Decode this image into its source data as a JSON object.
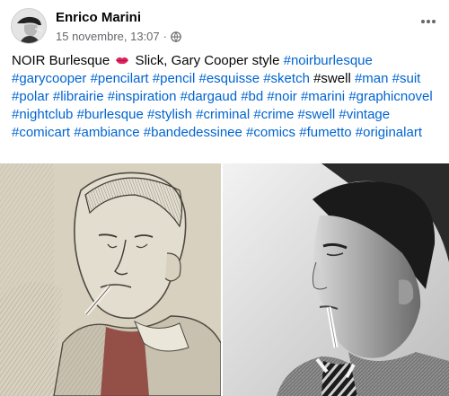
{
  "author": {
    "name": "Enrico Marini"
  },
  "meta": {
    "timestamp": "15 novembre, 13:07",
    "separator": "·",
    "audience_icon": "globe-icon"
  },
  "more_icon": "ellipsis-icon",
  "post": {
    "intro": "NOIR Burlesque",
    "emoji": "kiss-lips-emoji",
    "caption": " Slick, Gary Cooper style ",
    "tokens": [
      {
        "text": "#noirburlesque",
        "hashtag": true
      },
      {
        "text": "#garycooper",
        "hashtag": true
      },
      {
        "text": "#pencilart",
        "hashtag": true
      },
      {
        "text": "#pencil",
        "hashtag": true
      },
      {
        "text": "#esquisse",
        "hashtag": true
      },
      {
        "text": "#sketch",
        "hashtag": true
      },
      {
        "text": "#swell",
        "hashtag": false
      },
      {
        "text": "#man",
        "hashtag": true
      },
      {
        "text": "#suit",
        "hashtag": true
      },
      {
        "text": "#polar",
        "hashtag": true
      },
      {
        "text": "#librairie",
        "hashtag": true
      },
      {
        "text": "#inspiration",
        "hashtag": true
      },
      {
        "text": "#dargaud",
        "hashtag": true
      },
      {
        "text": "#bd",
        "hashtag": true
      },
      {
        "text": "#noir",
        "hashtag": true
      },
      {
        "text": "#marini",
        "hashtag": true
      },
      {
        "text": "#graphicnovel",
        "hashtag": true
      },
      {
        "text": "#nightclub",
        "hashtag": true
      },
      {
        "text": "#burlesque",
        "hashtag": true
      },
      {
        "text": "#stylish",
        "hashtag": true
      },
      {
        "text": "#criminal",
        "hashtag": true
      },
      {
        "text": "#crime",
        "hashtag": true
      },
      {
        "text": "#swell",
        "hashtag": true
      },
      {
        "text": "#vintage",
        "hashtag": true
      },
      {
        "text": "#comicart",
        "hashtag": true
      },
      {
        "text": "#ambiance",
        "hashtag": true
      },
      {
        "text": "#bandedessinee",
        "hashtag": true
      },
      {
        "text": "#comics",
        "hashtag": true
      },
      {
        "text": "#fumetto",
        "hashtag": true
      },
      {
        "text": "#originalart",
        "hashtag": true
      }
    ]
  },
  "images": {
    "left_icon": "pencil-sketch-portrait",
    "right_icon": "black-and-white-photo-portrait"
  },
  "colors": {
    "hashtag": "#0064d1",
    "text": "#050505",
    "secondary": "#65676b",
    "sketch_paper": "#d8d1c0",
    "tie_red": "#8e3b35"
  }
}
